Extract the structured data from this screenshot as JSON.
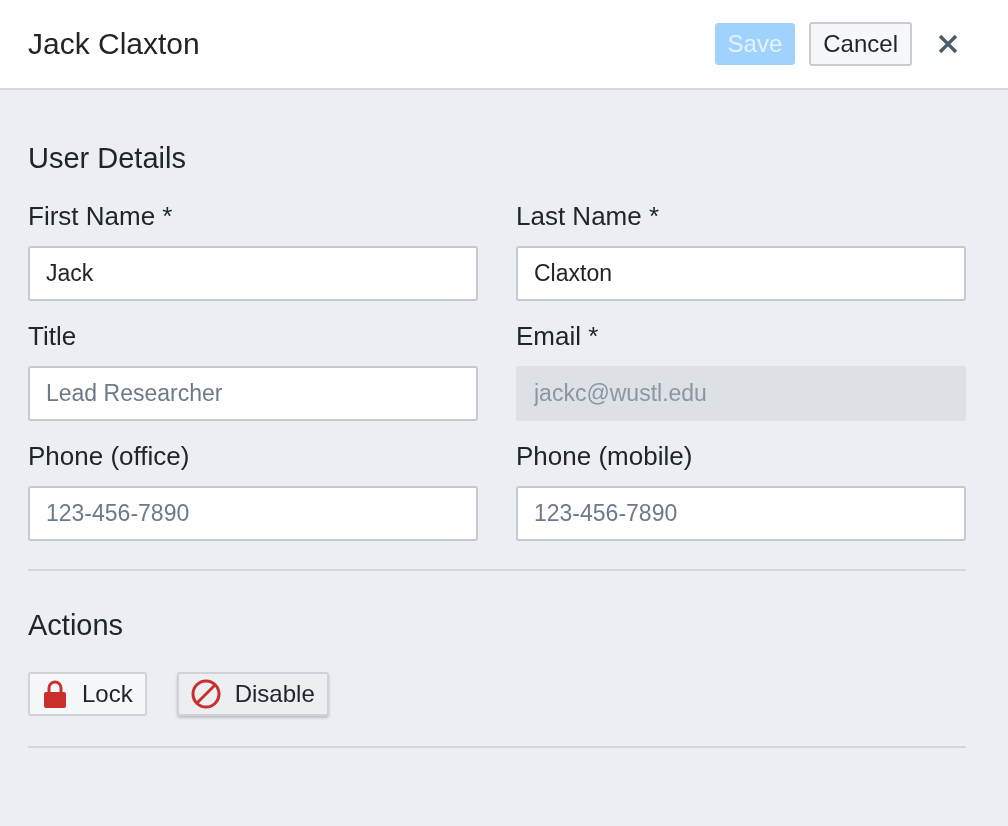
{
  "header": {
    "title": "Jack Claxton",
    "save": {
      "label": "Save",
      "disabled": true
    },
    "cancel": {
      "label": "Cancel",
      "disabled": false
    }
  },
  "user_details": {
    "heading": "User Details",
    "fields": [
      {
        "label": "First Name *",
        "value": "Jack",
        "disabled": false
      },
      {
        "label": "Last Name *",
        "value": "Claxton",
        "disabled": false
      },
      {
        "label": "Title",
        "placeholder": "Lead Researcher",
        "disabled": false
      },
      {
        "label": "Email *",
        "value": "jackc@wustl.edu",
        "disabled": true
      },
      {
        "label": "Phone (office)",
        "placeholder": "123-456-7890",
        "disabled": false
      },
      {
        "label": "Phone (mobile)",
        "placeholder": "123-456-7890",
        "disabled": false
      }
    ]
  },
  "actions": {
    "heading": "Actions",
    "buttons": [
      {
        "kind": "lock",
        "label": "Lock"
      },
      {
        "kind": "disable",
        "label": "Disable"
      }
    ]
  }
}
